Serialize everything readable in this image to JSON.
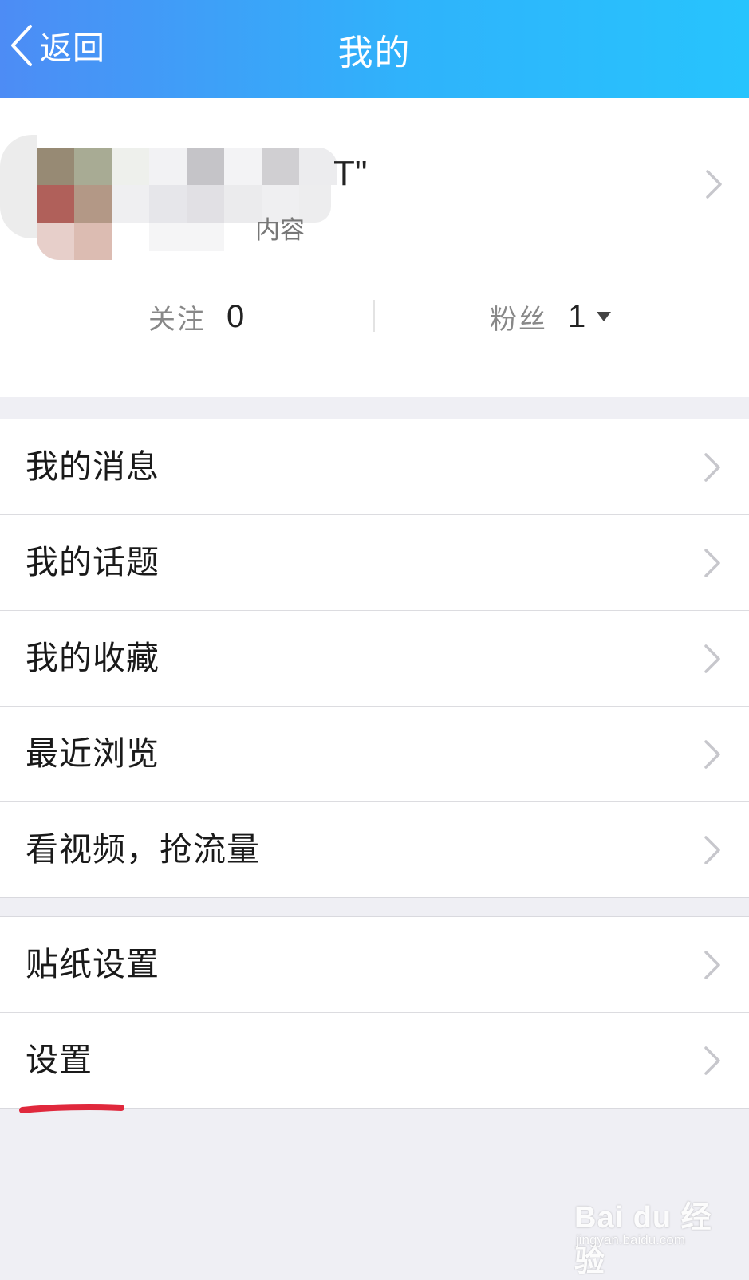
{
  "header": {
    "back_label": "返回",
    "title": "我的"
  },
  "profile": {
    "name_partial": "T\"",
    "subtitle_partial": "内容",
    "stats": {
      "following_label": "关注",
      "following_value": "0",
      "fans_label": "粉丝",
      "fans_value": "1"
    }
  },
  "menu_group_1": [
    {
      "label": "我的消息",
      "icon": "chevron-right-icon"
    },
    {
      "label": "我的话题",
      "icon": "chevron-right-icon"
    },
    {
      "label": "我的收藏",
      "icon": "chevron-right-icon"
    },
    {
      "label": "最近浏览",
      "icon": "chevron-right-icon"
    },
    {
      "label": "看视频，抢流量",
      "icon": "chevron-right-icon"
    }
  ],
  "menu_group_2": [
    {
      "label": "贴纸设置",
      "icon": "chevron-right-icon"
    },
    {
      "label": "设置",
      "icon": "chevron-right-icon"
    }
  ],
  "colors": {
    "header_gradient_start": "#4d8cf5",
    "header_gradient_end": "#27c4fd",
    "annotation_underline": "#e0283c"
  },
  "watermark": {
    "main": "Bai du 经验",
    "sub": "jingyan.baidu.com"
  }
}
